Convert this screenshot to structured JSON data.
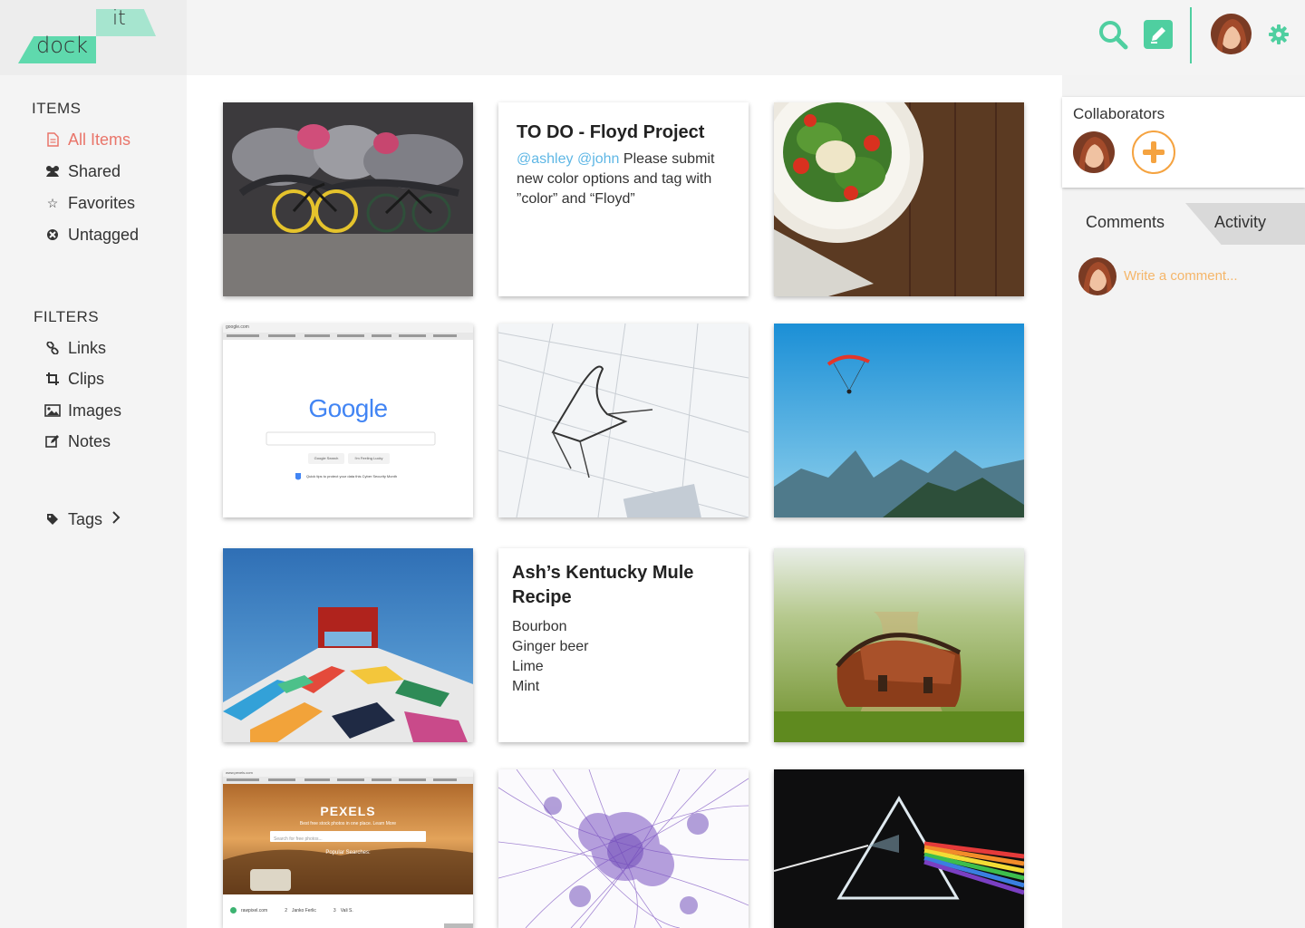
{
  "app": {
    "logo_top": "it",
    "logo_bottom": "dock",
    "brand_color": "#4fcfa0",
    "accent_color": "#e9756a",
    "mention_color": "#5fb7e5",
    "add_color": "#f5a340"
  },
  "header": {
    "search_icon": "search-icon",
    "edit_icon": "pencil-square-icon",
    "settings_icon": "gear-icon"
  },
  "sidebar": {
    "items_title": "ITEMS",
    "items": [
      {
        "label": "All Items",
        "icon": "file-icon",
        "active": true
      },
      {
        "label": "Shared",
        "icon": "users-icon"
      },
      {
        "label": "Favorites",
        "icon": "star-icon"
      },
      {
        "label": "Untagged",
        "icon": "untagged-icon"
      }
    ],
    "filters_title": "FILTERS",
    "filters": [
      {
        "label": "Links",
        "icon": "link-icon"
      },
      {
        "label": "Clips",
        "icon": "crop-icon"
      },
      {
        "label": "Images",
        "icon": "image-icon"
      },
      {
        "label": "Notes",
        "icon": "edit-icon"
      }
    ],
    "tags_label": "Tags"
  },
  "notes": {
    "todo": {
      "title": "TO DO - Floyd Project",
      "mention_1": "@ashley",
      "mention_2": "@john",
      "body": " Please submit new color options and tag with ”color” and “Floyd”"
    },
    "recipe": {
      "title": "Ash’s Kentucky Mule Recipe",
      "ingredients": [
        "Bourbon",
        "Ginger beer",
        "Lime",
        "Mint"
      ]
    }
  },
  "clips": {
    "google": {
      "url": "google.com",
      "logo": "Google",
      "button_1": "Google Search",
      "button_2": "I'm Feeling Lucky",
      "tip": "Quick tips to protect your data this Cyber Security Month"
    },
    "pexels": {
      "url": "www.pexels.com",
      "logo": "PEXELS",
      "tagline": "Best free stock photos in one place.",
      "tagline_link": "Learn More",
      "search_placeholder": "Search for free photos...",
      "popular_title": "Popular Searches:",
      "footer_1": "rawpixel.com",
      "footer_2": "2",
      "footer_3": "Janko Ferlic",
      "footer_4": "3",
      "footer_5": "Vali S."
    }
  },
  "right_panel": {
    "collaborators_title": "Collaborators",
    "tabs": [
      "Comments",
      "Activity"
    ],
    "comment_placeholder": "Write a comment..."
  }
}
